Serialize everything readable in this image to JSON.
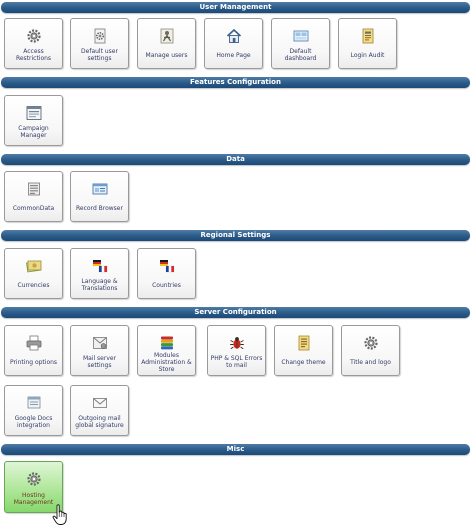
{
  "sections": {
    "user_management": {
      "title": "User Management",
      "items": [
        {
          "label": "Access Restrictions",
          "icon": "gear-icon"
        },
        {
          "label": "Default user settings",
          "icon": "gear-document-icon"
        },
        {
          "label": "Manage users",
          "icon": "users-icon"
        },
        {
          "label": "Home Page",
          "icon": "home-icon"
        },
        {
          "label": "Default dashboard",
          "icon": "dashboard-icon"
        },
        {
          "label": "Login Audit",
          "icon": "audit-icon"
        }
      ]
    },
    "features_configuration": {
      "title": "Features Configuration",
      "items": [
        {
          "label": "Campaign Manager",
          "icon": "campaign-icon"
        }
      ]
    },
    "data": {
      "title": "Data",
      "items": [
        {
          "label": "CommonData",
          "icon": "data-list-icon"
        },
        {
          "label": "Record Browser",
          "icon": "record-browser-icon"
        }
      ]
    },
    "regional_settings": {
      "title": "Regional Settings",
      "items": [
        {
          "label": "Currencies",
          "icon": "currency-icon"
        },
        {
          "label": "Language & Translations",
          "icon": "flags-icon"
        },
        {
          "label": "Countries",
          "icon": "flags-icon"
        }
      ]
    },
    "server_configuration": {
      "title": "Server Configuration",
      "items": [
        {
          "label": "Printing options",
          "icon": "printer-icon"
        },
        {
          "label": "Mail server settings",
          "icon": "mail-server-icon"
        },
        {
          "label": "Modules Administration & Store",
          "icon": "modules-icon"
        },
        {
          "label": "PHP & SQL Errors to mail",
          "icon": "bug-icon"
        },
        {
          "label": "Change theme",
          "icon": "theme-icon"
        },
        {
          "label": "Title and logo",
          "icon": "gear-icon"
        },
        {
          "label": "Google Docs integration",
          "icon": "google-docs-icon"
        },
        {
          "label": "Outgoing mail global signature",
          "icon": "envelope-icon"
        }
      ]
    },
    "misc": {
      "title": "Misc",
      "items": [
        {
          "label": "Hosting Management",
          "icon": "gear-icon",
          "highlighted": true
        }
      ]
    }
  },
  "colors": {
    "header_bar": "#2a5a88",
    "tile_label": "#333b66",
    "highlight_tile": "#9de287"
  }
}
